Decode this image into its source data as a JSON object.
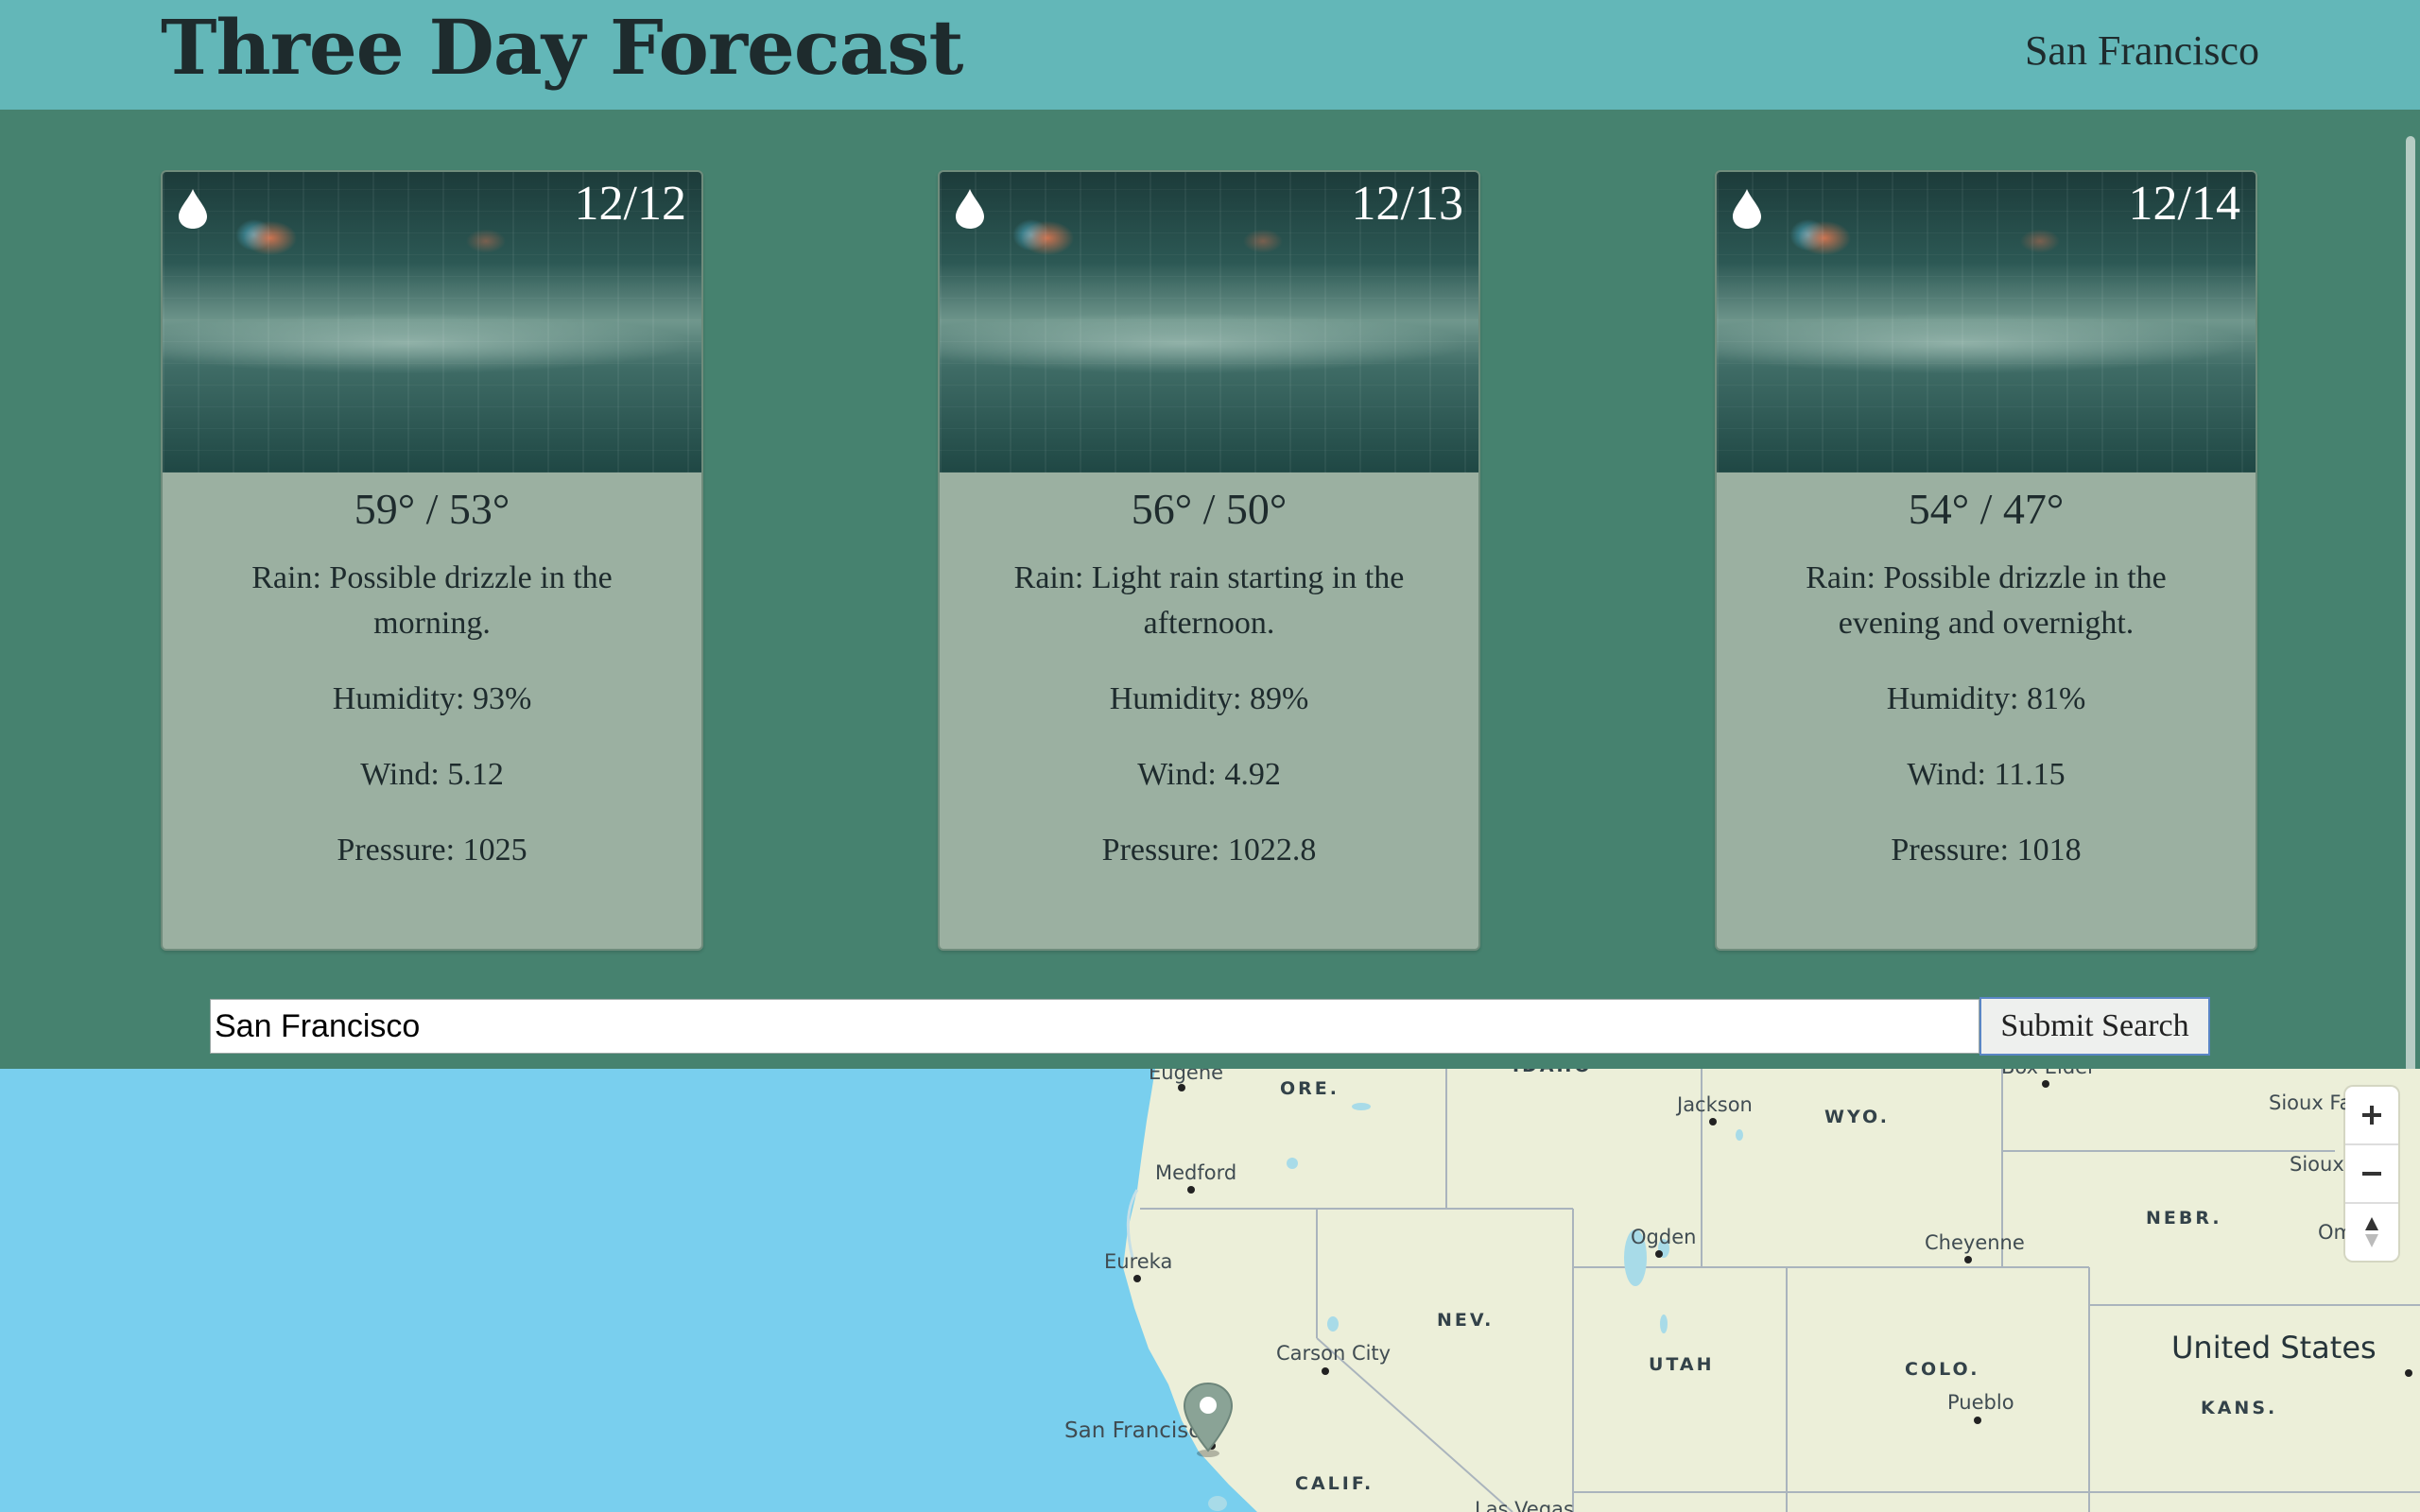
{
  "header": {
    "title": "Three Day Forecast",
    "city": "San Francisco"
  },
  "forecast": [
    {
      "date": "12/12",
      "icon": "raindrop-icon",
      "temps": "59° / 53°",
      "rain_label": "Rain:",
      "rain": "Possible drizzle in the morning.",
      "humidity_label": "Humidity:",
      "humidity": "93%",
      "wind_label": "Wind:",
      "wind": "5.12",
      "pressure_label": "Pressure:",
      "pressure": "1025"
    },
    {
      "date": "12/13",
      "icon": "raindrop-icon",
      "temps": "56° / 50°",
      "rain_label": "Rain:",
      "rain": "Light rain starting in the afternoon.",
      "humidity_label": "Humidity:",
      "humidity": "89%",
      "wind_label": "Wind:",
      "wind": "4.92",
      "pressure_label": "Pressure:",
      "pressure": "1022.8"
    },
    {
      "date": "12/14",
      "icon": "raindrop-icon",
      "temps": "54° / 47°",
      "rain_label": "Rain:",
      "rain": "Possible drizzle in the evening and overnight.",
      "humidity_label": "Humidity:",
      "humidity": "81%",
      "wind_label": "Wind:",
      "wind": "11.15",
      "pressure_label": "Pressure:",
      "pressure": "1018"
    }
  ],
  "search": {
    "value": "San Francisco",
    "button_label": "Submit Search"
  },
  "map": {
    "cities": [
      "Eugene",
      "Jackson",
      "Box Elder",
      "Sioux Fa",
      "Medford",
      "Sioux C",
      "Om",
      "Ogden",
      "Cheyenne",
      "Eureka",
      "Carson City",
      "Pueblo",
      "San Francisco",
      "Las Vegas"
    ],
    "states": [
      "IDAHO",
      "ORE.",
      "WYO.",
      "NEBR.",
      "NEV.",
      "UTAH",
      "COLO.",
      "KANS.",
      "CALIF."
    ],
    "country": "United States",
    "controls": {
      "zoom_in_icon": "plus-icon",
      "zoom_out_icon": "minus-icon",
      "compass_icon": "compass-icon"
    },
    "colors": {
      "water": "#79cfee",
      "land": "#ecefd9",
      "marker": "#8aa396"
    }
  },
  "colors": {
    "header": "#63b7b8",
    "main": "#46826f",
    "card": "#9bb0a1"
  }
}
